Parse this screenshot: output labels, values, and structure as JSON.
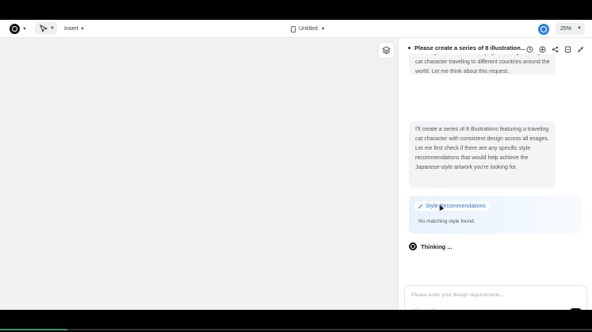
{
  "topbar": {
    "insert_label": "Insert",
    "doc_title": "Untitled",
    "zoom_label": "25%"
  },
  "panel": {
    "title": "Please create a series of 8 illustration...",
    "messages": [
      {
        "text": "featuring a cream-colored, upright-walking chibi-style cat character traveling to different countries around the world. Let me think about this request."
      },
      {
        "text": "I'll create a series of 8 illustrations featuring a traveling cat character with consistent design across all images. Let me first check if there are any specific style recommendations that would help achieve the Japanese-style artwork you're looking for."
      }
    ],
    "style_card": {
      "chip_label": "Style Recommendations",
      "result_text": "No matching style found."
    },
    "thinking_label": "Thinking ...",
    "input_placeholder": "Please enter your design requirements..."
  },
  "colors": {
    "accent": "#2f7de1",
    "canvas_bg": "#f0f1f3"
  }
}
